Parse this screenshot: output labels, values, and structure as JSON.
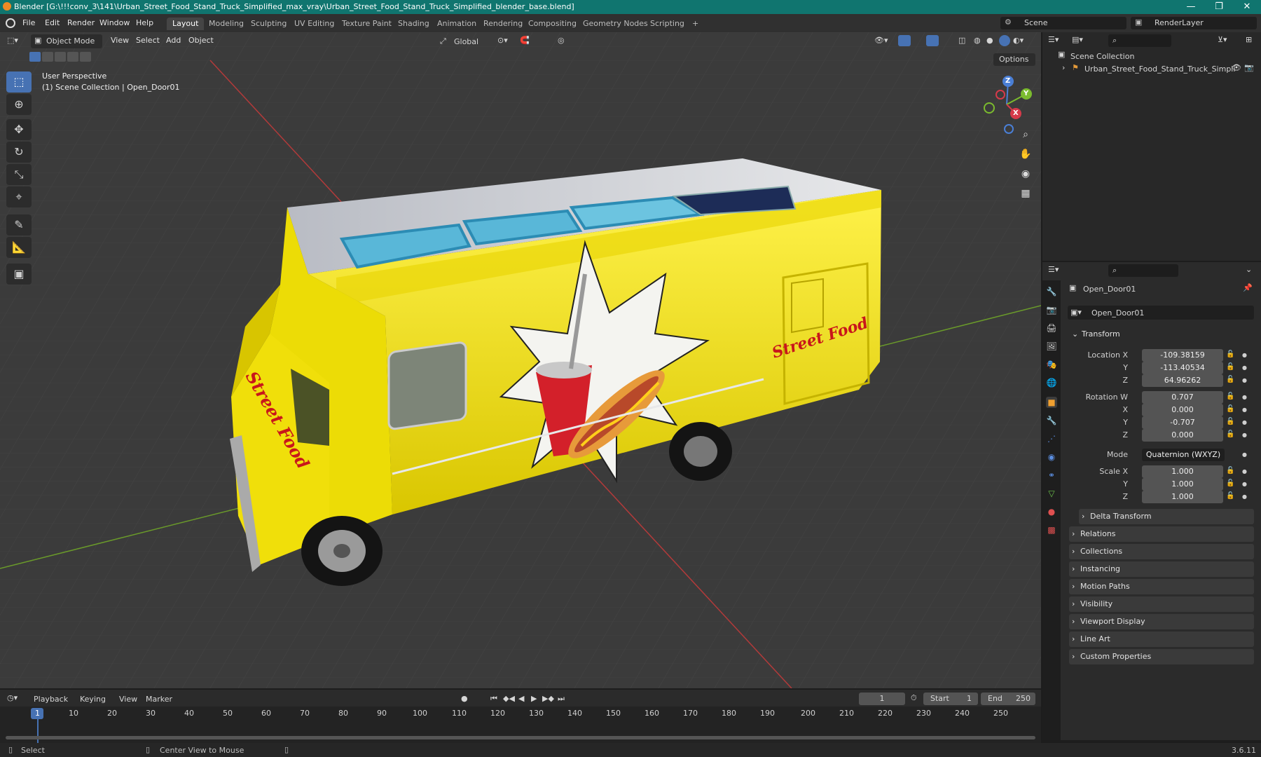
{
  "window": {
    "title": "Blender [G:\\!!!conv_3\\141\\Urban_Street_Food_Stand_Truck_Simplified_max_vray\\Urban_Street_Food_Stand_Truck_Simplified_blender_base.blend]",
    "minimize": "—",
    "maximize": "❐",
    "close": "✕"
  },
  "menu": {
    "items": [
      "File",
      "Edit",
      "Render",
      "Window",
      "Help"
    ],
    "workspaces": [
      "Layout",
      "Modeling",
      "Sculpting",
      "UV Editing",
      "Texture Paint",
      "Shading",
      "Animation",
      "Rendering",
      "Compositing",
      "Geometry Nodes",
      "Scripting",
      "+"
    ],
    "active_workspace": "Layout",
    "scene": "Scene",
    "render_layer": "RenderLayer"
  },
  "viewport": {
    "mode": "Object Mode",
    "menus": [
      "View",
      "Select",
      "Add",
      "Object"
    ],
    "orientation": "Global",
    "options_label": "Options",
    "overlay_title": "User Perspective",
    "overlay_subtitle": "(1) Scene Collection | Open_Door01",
    "gizmo_axes": [
      "Z",
      "Y",
      "X"
    ],
    "truck_text_side": "Street Food",
    "truck_text_front": "Street Food"
  },
  "outliner": {
    "root": "Scene Collection",
    "item": "Urban_Street_Food_Stand_Truck_Simpli"
  },
  "properties": {
    "object_name": "Open_Door01",
    "data_name": "Open_Door01",
    "transform_label": "Transform",
    "location": {
      "label": "Location X",
      "x": "-109.38159",
      "y": "-113.40534",
      "z": "64.96262"
    },
    "rotation": {
      "label": "Rotation W",
      "w": "0.707",
      "x": "0.000",
      "y": "-0.707",
      "z": "0.000"
    },
    "mode": {
      "label": "Mode",
      "value": "Quaternion (WXYZ)"
    },
    "scale": {
      "label": "Scale X",
      "x": "1.000",
      "y": "1.000",
      "z": "1.000"
    },
    "axis_labels": {
      "x": "X",
      "y": "Y",
      "z": "Z"
    },
    "delta_transform": "Delta Transform",
    "panels": [
      "Relations",
      "Collections",
      "Instancing",
      "Motion Paths",
      "Visibility",
      "Viewport Display",
      "Line Art",
      "Custom Properties"
    ]
  },
  "timeline": {
    "menus": [
      "Playback",
      "Keying",
      "View",
      "Marker"
    ],
    "current_frame": "1",
    "start_label": "Start",
    "start": "1",
    "end_label": "End",
    "end": "250",
    "ruler": [
      "1",
      "10",
      "20",
      "30",
      "40",
      "50",
      "60",
      "70",
      "80",
      "90",
      "100",
      "110",
      "120",
      "130",
      "140",
      "150",
      "160",
      "170",
      "180",
      "190",
      "200",
      "210",
      "220",
      "230",
      "240",
      "250"
    ]
  },
  "status": {
    "left": "Select",
    "middle": "Center View to Mouse",
    "version": "3.6.11"
  },
  "colors": {
    "accent": "#4772b3",
    "titlebar": "#10756f",
    "truck_yellow": "#f2e000"
  }
}
